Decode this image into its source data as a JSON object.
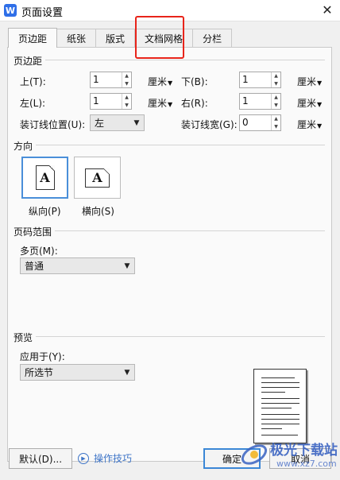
{
  "window": {
    "app_icon": "wps-writer-icon",
    "app_icon_letter": "W",
    "title": "页面设置",
    "close_glyph": "✕"
  },
  "tabs": [
    {
      "label": "页边距",
      "active": true
    },
    {
      "label": "纸张",
      "active": false
    },
    {
      "label": "版式",
      "active": false
    },
    {
      "label": "文档网格",
      "active": false
    },
    {
      "label": "分栏",
      "active": false
    }
  ],
  "margins": {
    "section_title": "页边距",
    "top": {
      "label": "上(T):",
      "value": "1",
      "unit": "厘米"
    },
    "bottom": {
      "label": "下(B):",
      "value": "1",
      "unit": "厘米"
    },
    "left": {
      "label": "左(L):",
      "value": "1",
      "unit": "厘米"
    },
    "right": {
      "label": "右(R):",
      "value": "1",
      "unit": "厘米"
    },
    "gutter_position": {
      "label": "装订线位置(U):",
      "value": "左"
    },
    "gutter_width": {
      "label": "装订线宽(G):",
      "value": "0",
      "unit": "厘米"
    }
  },
  "orientation": {
    "section_title": "方向",
    "portrait": {
      "label": "纵向(P)",
      "glyph": "A",
      "selected": true
    },
    "landscape": {
      "label": "横向(S)",
      "glyph": "A",
      "selected": false
    }
  },
  "pages": {
    "section_title": "页码范围",
    "multiple_pages": {
      "label": "多页(M):",
      "value": "普通"
    }
  },
  "preview": {
    "section_title": "预览",
    "apply_to": {
      "label": "应用于(Y):",
      "value": "所选节"
    }
  },
  "footer": {
    "default_button": "默认(D)...",
    "tips_label": "操作技巧",
    "ok_button": "确定",
    "cancel_button": "取消"
  },
  "watermark": {
    "text": "极光下载站",
    "url": "www.xz7.com"
  },
  "colors": {
    "highlight": "#e8241a",
    "accent": "#3b87d6",
    "link": "#3d74c7"
  }
}
